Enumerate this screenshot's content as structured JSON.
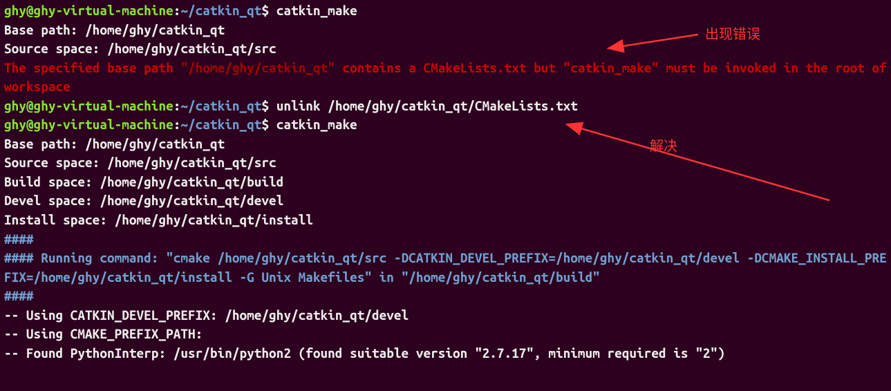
{
  "prompt": {
    "user": "ghy@ghy-virtual-machine",
    "sep": ":",
    "path": "~/catkin_qt",
    "suffix": "$"
  },
  "cmd1": "catkin_make",
  "out1_line1": "Base path: /home/ghy/catkin_qt",
  "out1_line2": "Source space: /home/ghy/catkin_qt/src",
  "err_part1": "The specified base path ",
  "err_quoted": "\"/home/ghy/catkin_qt\"",
  "err_part2": " contains a CMakeLists.txt but \"catkin_make\" must be invoked in the root of workspace",
  "cmd2": "unlink /home/ghy/catkin_qt/CMakeLists.txt",
  "cmd3": "catkin_make",
  "out2": {
    "l1": "Base path: /home/ghy/catkin_qt",
    "l2": "Source space: /home/ghy/catkin_qt/src",
    "l3": "Build space: /home/ghy/catkin_qt/build",
    "l4": "Devel space: /home/ghy/catkin_qt/devel",
    "l5": "Install space: /home/ghy/catkin_qt/install"
  },
  "hash1": "####",
  "running_prefix": "#### ",
  "running_label": "Running command: ",
  "running_cmd": "\"cmake /home/ghy/catkin_qt/src -DCATKIN_DEVEL_PREFIX=/home/ghy/catkin_qt/devel -DCMAKE_INSTALL_PREFIX=/home/ghy/catkin_qt/install -G Unix Makefiles\"",
  "running_in": " in ",
  "running_path": "\"/home/ghy/catkin_qt/build\"",
  "hash2": "####",
  "out3": {
    "l1": "-- Using CATKIN_DEVEL_PREFIX: /home/ghy/catkin_qt/devel",
    "l2": "-- Using CMAKE_PREFIX_PATH:",
    "l3": "-- Found PythonInterp: /usr/bin/python2 (found suitable version \"2.7.17\", minimum required is \"2\")"
  },
  "annotations": {
    "error_label": "出现错误",
    "fix_label": "解决"
  }
}
